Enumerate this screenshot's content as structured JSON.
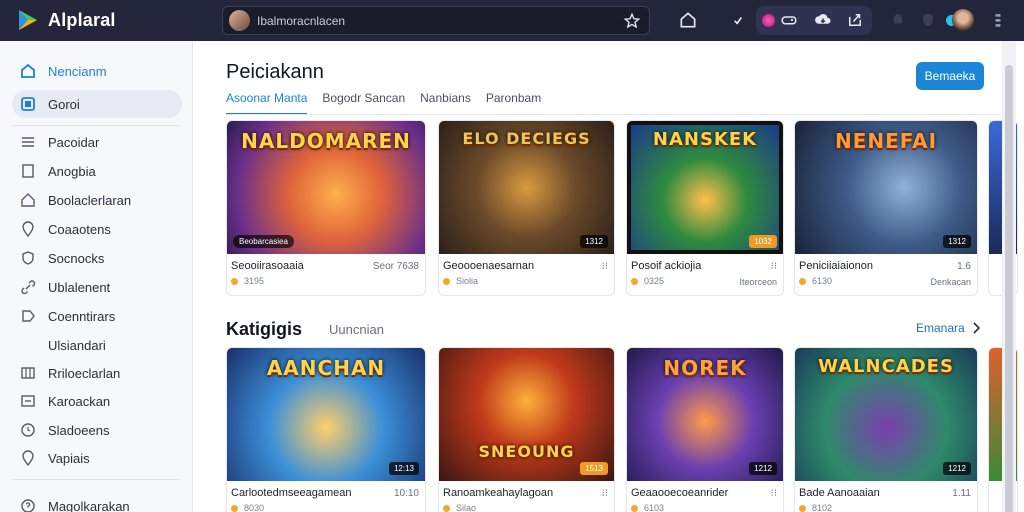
{
  "app": {
    "title": "Alplaral"
  },
  "search": {
    "text": "Ibalmoracnlacen"
  },
  "sidebar": {
    "items": [
      {
        "label": "Nencianm",
        "icon": "home-icon"
      },
      {
        "label": "Goroi",
        "icon": "library-icon"
      },
      {
        "label": "Pacoidar",
        "icon": "list-icon"
      },
      {
        "label": "Anogbia",
        "icon": "square-icon"
      },
      {
        "label": "Boolaclerlaran",
        "icon": "house-outline-icon"
      },
      {
        "label": "Coaaotens",
        "icon": "location-pin-icon"
      },
      {
        "label": "Socnocks",
        "icon": "shield-icon"
      },
      {
        "label": "Ublalenent",
        "icon": "link-icon"
      },
      {
        "label": "Coenntirars",
        "icon": "tag-icon"
      },
      {
        "label": "Ulsiandari",
        "icon": ""
      },
      {
        "label": "Rriloeclarlan",
        "icon": "grid-icon"
      },
      {
        "label": "Karoackan",
        "icon": "card-icon"
      },
      {
        "label": "Sladoeens",
        "icon": "clock-icon"
      },
      {
        "label": "Vapiais",
        "icon": "pin-icon"
      },
      {
        "label": "Magolkarakan",
        "icon": "help-icon"
      }
    ]
  },
  "main": {
    "title": "Peiciakann",
    "primary_button": "Bemaeka",
    "tabs": [
      "Asoonar Manta",
      "Bogodr Sancan",
      "Nanbians",
      "Paronbam"
    ],
    "row1": [
      {
        "thumb_title": "NALDOMAREN",
        "chip": "Beobarcasiea",
        "badge": "",
        "name": "Seooiirasoaaia",
        "right": "Seor 7638",
        "meta": "3195"
      },
      {
        "thumb_title": "ELO DECIEGS",
        "chip": "",
        "badge": "1312",
        "name": "Geoooenaesarnan",
        "right": "",
        "meta": "Siolia"
      },
      {
        "thumb_title": "NANSKEK",
        "chip": "",
        "badge": "1032",
        "name": "Posoif ackiojia",
        "right": "",
        "meta": "0325",
        "meta_right": "Iteorceon"
      },
      {
        "thumb_title": "NENEFAI",
        "chip": "",
        "badge": "1312",
        "name": "Peniciiaiaionon",
        "right": "1.6",
        "meta": "6130",
        "meta_right": "Denkacan"
      }
    ],
    "section": {
      "title": "Katigigis",
      "subtitle": "Uuncnian",
      "link": "Emanara"
    },
    "row2": [
      {
        "thumb_title": "AANCHAN",
        "badge": "12:13",
        "name": "Carlootedmseeagamean",
        "right": "10:10",
        "meta": "8030"
      },
      {
        "thumb_title": "SNEOUNG",
        "badge": "1513",
        "name": "Ranoamkeahaylagoan",
        "right": "",
        "meta": "Silao"
      },
      {
        "thumb_title": "NOREK",
        "badge": "1212",
        "name": "Geaaooecoeanrider",
        "right": "",
        "meta": "6103"
      },
      {
        "thumb_title": "WALNCADES",
        "badge": "1212",
        "name": "Bade Aanoaaian",
        "right": "1.11",
        "meta": "8102"
      }
    ]
  },
  "colors": {
    "topbar": "#23263a",
    "accent": "#1f7fd6",
    "button": "#1c86d6"
  }
}
